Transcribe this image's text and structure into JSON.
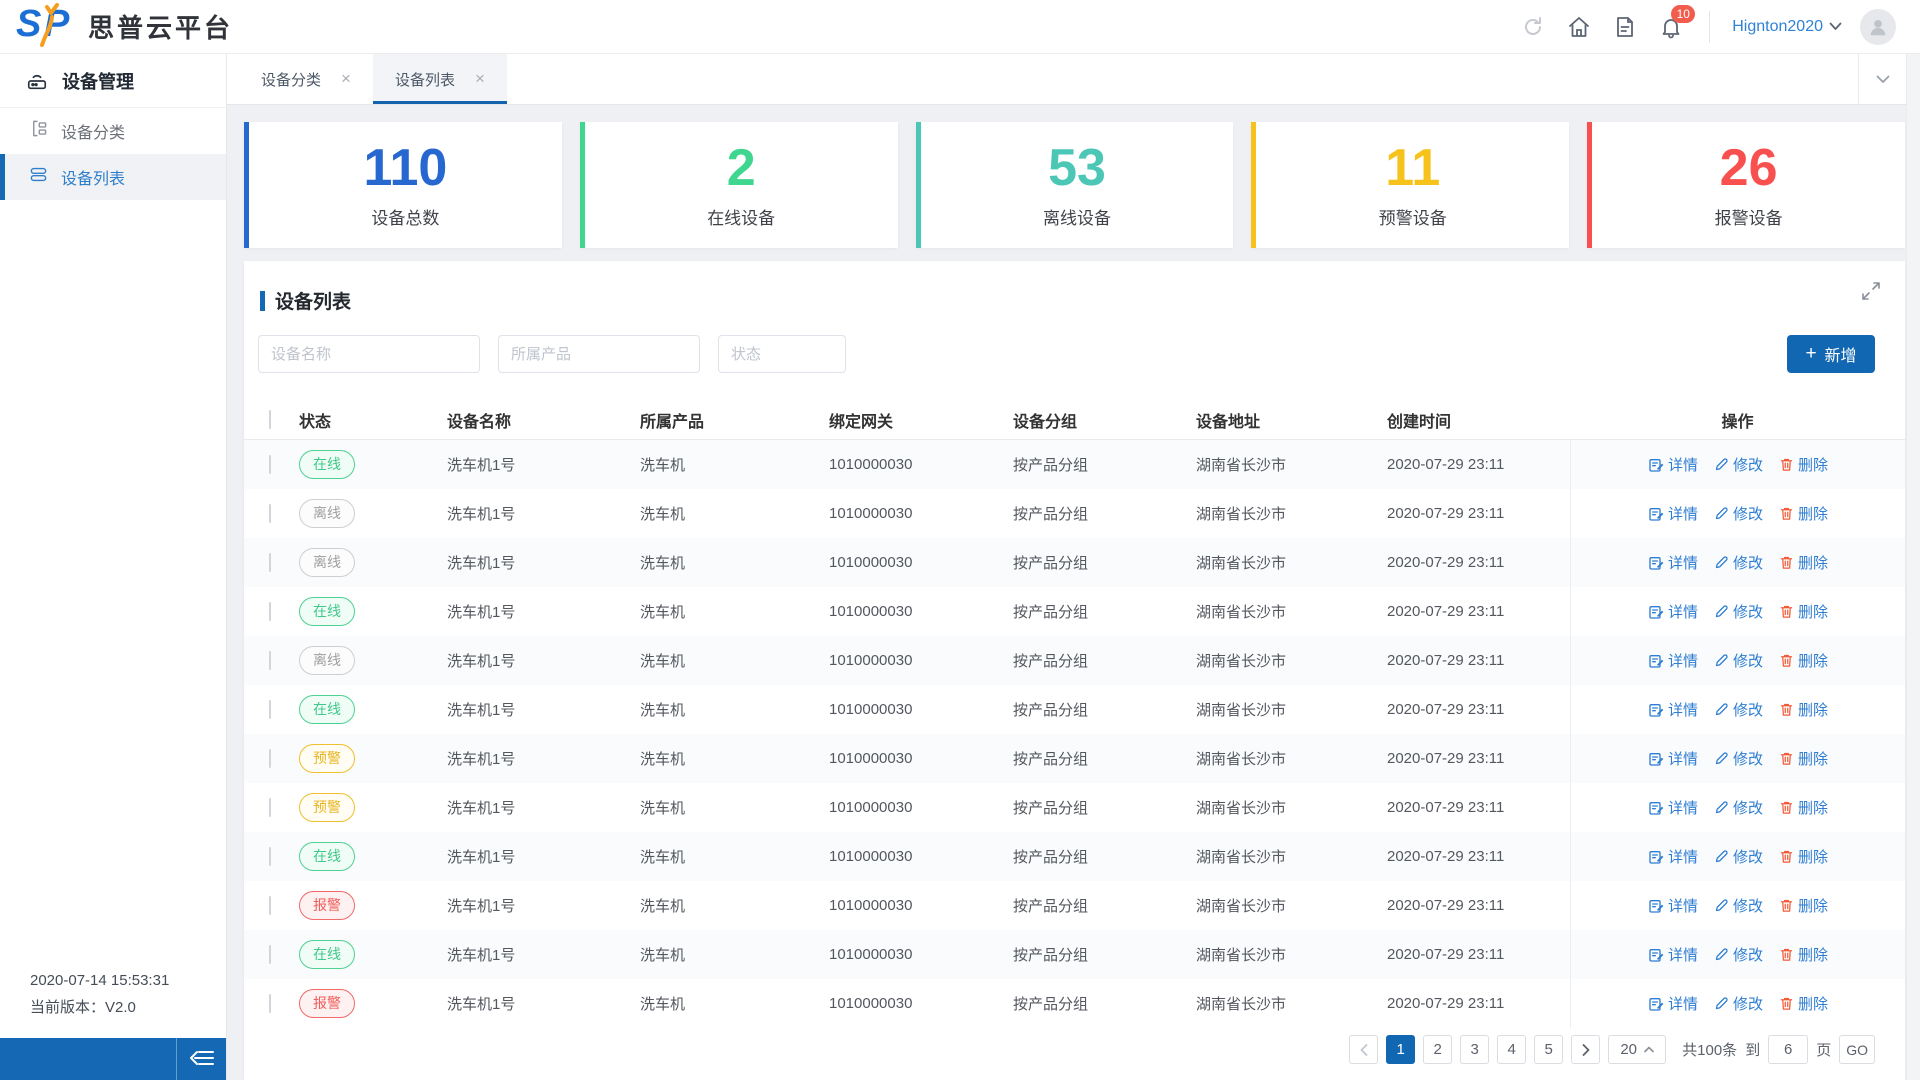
{
  "app": {
    "logo_s": "S",
    "logo_p": "P",
    "brand": "思普云平台"
  },
  "header": {
    "notification_count": "10",
    "username": "Hignton2020"
  },
  "sidebar": {
    "title": "设备管理",
    "items": [
      {
        "label": "设备分类",
        "active": false
      },
      {
        "label": "设备列表",
        "active": true
      }
    ],
    "footer": {
      "timestamp": "2020-07-14 15:53:31",
      "version": "当前版本：V2.0"
    }
  },
  "tabs": [
    {
      "label": "设备分类",
      "active": false
    },
    {
      "label": "设备列表",
      "active": true
    }
  ],
  "icons": {
    "close": "×",
    "plus": "+"
  },
  "stats": [
    {
      "value": "110",
      "label": "设备总数",
      "color": "#2667d0"
    },
    {
      "value": "2",
      "label": "在线设备",
      "color": "#3fd68f"
    },
    {
      "value": "53",
      "label": "离线设备",
      "color": "#4cc7b5"
    },
    {
      "value": "11",
      "label": "预警设备",
      "color": "#f6c31c"
    },
    {
      "value": "26",
      "label": "报警设备",
      "color": "#f8504e"
    }
  ],
  "panel": {
    "title": "设备列表",
    "filters": {
      "name_placeholder": "设备名称",
      "product_placeholder": "所属产品",
      "status_placeholder": "状态"
    },
    "add_button": "新增"
  },
  "table": {
    "columns": [
      "状态",
      "设备名称",
      "所属产品",
      "绑定网关",
      "设备分组",
      "设备地址",
      "创建时间",
      "操作"
    ],
    "actions": {
      "detail": "详情",
      "edit": "修改",
      "delete": "删除"
    },
    "statuses": {
      "online": {
        "label": "在线",
        "color": "#40c988",
        "bg": "#f0fcf6",
        "border": "#4fd194"
      },
      "offline": {
        "label": "离线",
        "color": "#a0a0a0",
        "bg": "#fcfcfc",
        "border": "#cfcfcf"
      },
      "warning": {
        "label": "预警",
        "color": "#e9b51f",
        "bg": "#fffdf4",
        "border": "#f0c02e"
      },
      "alarm": {
        "label": "报警",
        "color": "#f15b5b",
        "bg": "#fdf2f1",
        "border": "#f26a6a"
      }
    },
    "rows": [
      {
        "status": "online",
        "name": "洗车机1号",
        "product": "洗车机",
        "gateway": "1010000030",
        "group": "按产品分组",
        "address": "湖南省长沙市",
        "created": "2020-07-29 23:11"
      },
      {
        "status": "offline",
        "name": "洗车机1号",
        "product": "洗车机",
        "gateway": "1010000030",
        "group": "按产品分组",
        "address": "湖南省长沙市",
        "created": "2020-07-29 23:11"
      },
      {
        "status": "offline",
        "name": "洗车机1号",
        "product": "洗车机",
        "gateway": "1010000030",
        "group": "按产品分组",
        "address": "湖南省长沙市",
        "created": "2020-07-29 23:11"
      },
      {
        "status": "online",
        "name": "洗车机1号",
        "product": "洗车机",
        "gateway": "1010000030",
        "group": "按产品分组",
        "address": "湖南省长沙市",
        "created": "2020-07-29 23:11"
      },
      {
        "status": "offline",
        "name": "洗车机1号",
        "product": "洗车机",
        "gateway": "1010000030",
        "group": "按产品分组",
        "address": "湖南省长沙市",
        "created": "2020-07-29 23:11"
      },
      {
        "status": "online",
        "name": "洗车机1号",
        "product": "洗车机",
        "gateway": "1010000030",
        "group": "按产品分组",
        "address": "湖南省长沙市",
        "created": "2020-07-29 23:11"
      },
      {
        "status": "warning",
        "name": "洗车机1号",
        "product": "洗车机",
        "gateway": "1010000030",
        "group": "按产品分组",
        "address": "湖南省长沙市",
        "created": "2020-07-29 23:11"
      },
      {
        "status": "warning",
        "name": "洗车机1号",
        "product": "洗车机",
        "gateway": "1010000030",
        "group": "按产品分组",
        "address": "湖南省长沙市",
        "created": "2020-07-29 23:11"
      },
      {
        "status": "online",
        "name": "洗车机1号",
        "product": "洗车机",
        "gateway": "1010000030",
        "group": "按产品分组",
        "address": "湖南省长沙市",
        "created": "2020-07-29 23:11"
      },
      {
        "status": "alarm",
        "name": "洗车机1号",
        "product": "洗车机",
        "gateway": "1010000030",
        "group": "按产品分组",
        "address": "湖南省长沙市",
        "created": "2020-07-29 23:11"
      },
      {
        "status": "online",
        "name": "洗车机1号",
        "product": "洗车机",
        "gateway": "1010000030",
        "group": "按产品分组",
        "address": "湖南省长沙市",
        "created": "2020-07-29 23:11"
      },
      {
        "status": "alarm",
        "name": "洗车机1号",
        "product": "洗车机",
        "gateway": "1010000030",
        "group": "按产品分组",
        "address": "湖南省长沙市",
        "created": "2020-07-29 23:11"
      }
    ]
  },
  "pagination": {
    "pages": [
      "1",
      "2",
      "3",
      "4",
      "5"
    ],
    "active_page": "1",
    "page_size": "20",
    "total_text": "共100条",
    "goto_prefix": "到",
    "goto_value": "6",
    "goto_suffix": "页",
    "go_button": "GO"
  }
}
